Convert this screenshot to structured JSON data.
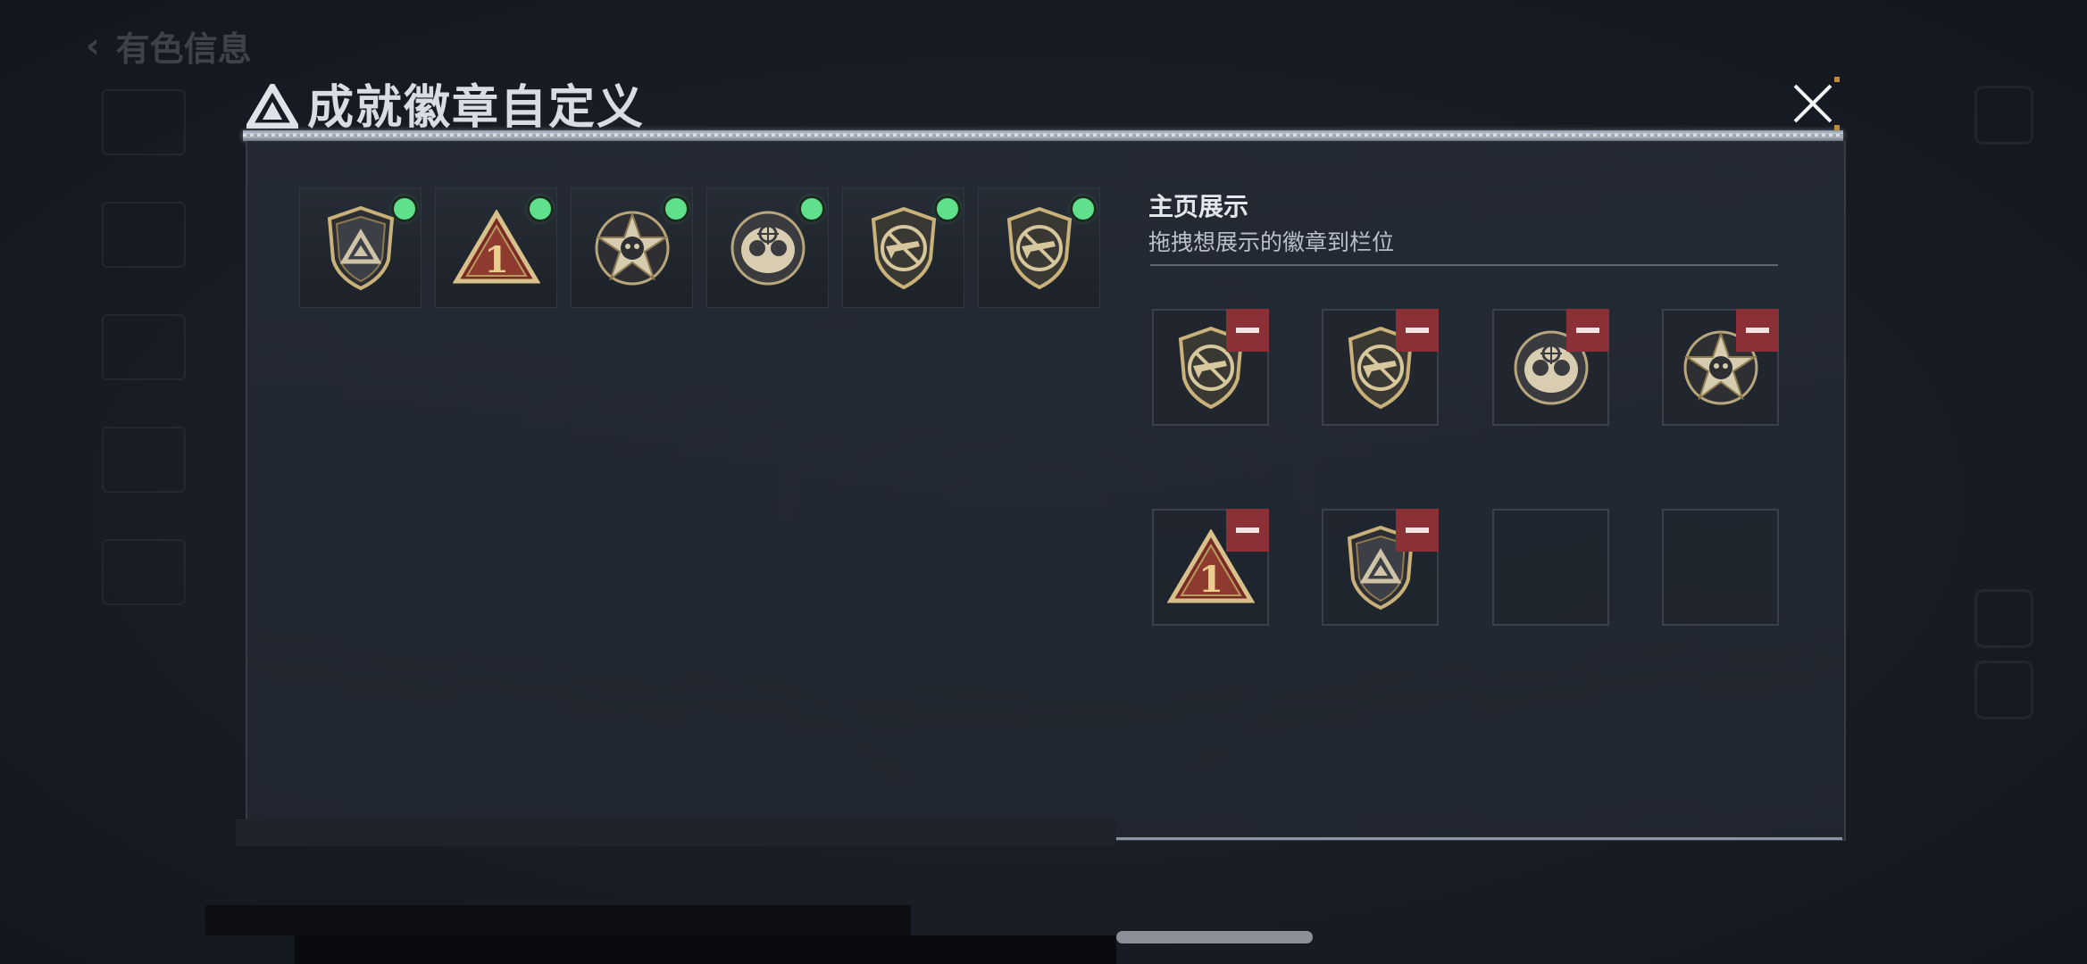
{
  "background": {
    "page_title": "有色信息"
  },
  "dialog": {
    "title": "成就徽章自定义",
    "logo_icon": "triangle-emblem-icon",
    "close_icon": "close-x-icon"
  },
  "inventory": {
    "badges": [
      {
        "icon": "triangle-shield-badge-icon",
        "selected": true
      },
      {
        "icon": "number-one-triangle-badge-icon",
        "selected": true
      },
      {
        "icon": "skull-star-badge-icon",
        "selected": true
      },
      {
        "icon": "crosshair-skull-badge-icon",
        "selected": true
      },
      {
        "icon": "rifle-shield-badge-icon",
        "selected": true
      },
      {
        "icon": "rifle-shield-badge-icon",
        "selected": true
      }
    ]
  },
  "showcase": {
    "title": "主页展示",
    "subtitle": "拖拽想展示的徽章到栏位",
    "slots": [
      {
        "icon": "rifle-shield-badge-icon",
        "filled": true
      },
      {
        "icon": "rifle-shield-badge-icon",
        "filled": true
      },
      {
        "icon": "crosshair-skull-badge-icon",
        "filled": true
      },
      {
        "icon": "skull-star-badge-icon",
        "filled": true
      },
      {
        "icon": "number-one-triangle-badge-icon",
        "filled": true
      },
      {
        "icon": "triangle-shield-badge-icon",
        "filled": true
      },
      {
        "icon": "",
        "filled": false
      },
      {
        "icon": "",
        "filled": false
      }
    ],
    "remove_icon": "minus-icon"
  },
  "colors": {
    "accent_green": "#5fe08a",
    "remove_red": "#8a3036",
    "gold": "#c9b27a"
  }
}
